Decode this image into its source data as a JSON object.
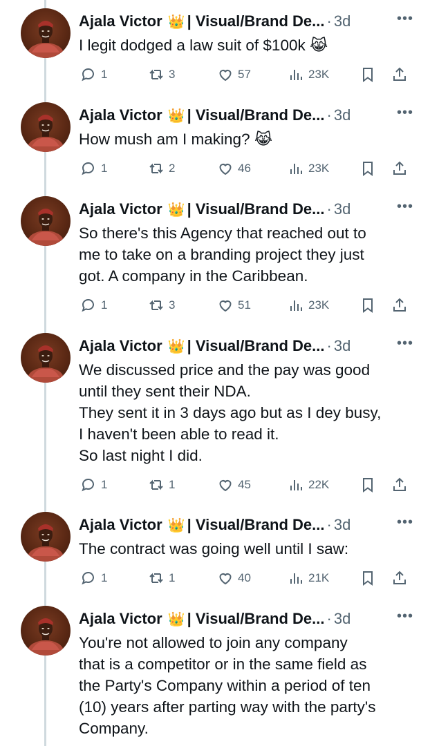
{
  "tweets": [
    {
      "author": "Ajala Victor",
      "crown": "👑",
      "title": "| Visual/Brand De...",
      "time": "3d",
      "lines": [
        "I legit dodged a law suit of $100k 😹"
      ],
      "replies": "1",
      "retweets": "3",
      "likes": "57",
      "views": "23K"
    },
    {
      "author": "Ajala Victor",
      "crown": "👑",
      "title": "| Visual/Brand De...",
      "time": "3d",
      "lines": [
        "How mush am I making? 😹"
      ],
      "replies": "1",
      "retweets": "2",
      "likes": "46",
      "views": "23K"
    },
    {
      "author": "Ajala Victor",
      "crown": "👑",
      "title": "| Visual/Brand De...",
      "time": "3d",
      "lines": [
        "So there's this Agency that reached out to",
        "me to take on a branding project they just",
        "got. A company in the Caribbean."
      ],
      "replies": "1",
      "retweets": "3",
      "likes": "51",
      "views": "23K"
    },
    {
      "author": "Ajala Victor",
      "crown": "👑",
      "title": "| Visual/Brand De...",
      "time": "3d",
      "lines": [
        "We discussed price and the pay was good",
        "until they sent their NDA.",
        "They sent it in 3 days ago but as I dey busy,",
        "I haven't been able to read it.",
        "So last night I did."
      ],
      "replies": "1",
      "retweets": "1",
      "likes": "45",
      "views": "22K"
    },
    {
      "author": "Ajala Victor",
      "crown": "👑",
      "title": "| Visual/Brand De...",
      "time": "3d",
      "lines": [
        "The contract was going well until I saw:"
      ],
      "replies": "1",
      "retweets": "1",
      "likes": "40",
      "views": "21K"
    },
    {
      "author": "Ajala Victor",
      "crown": "👑",
      "title": "| Visual/Brand De...",
      "time": "3d",
      "lines": [
        "You're not allowed to join any company",
        "that is a competitor or in the same field as",
        "the Party's Company within a period of ten",
        "(10) years after parting way with the party's",
        "Company."
      ],
      "replies": "",
      "retweets": "",
      "likes": "",
      "views": ""
    }
  ],
  "colors": {
    "text": "#0f1419",
    "muted": "#536471",
    "thread": "#cfd9de"
  },
  "icons": [
    "reply-icon",
    "retweet-icon",
    "like-icon",
    "views-icon",
    "bookmark-icon",
    "share-icon",
    "more-icon"
  ]
}
